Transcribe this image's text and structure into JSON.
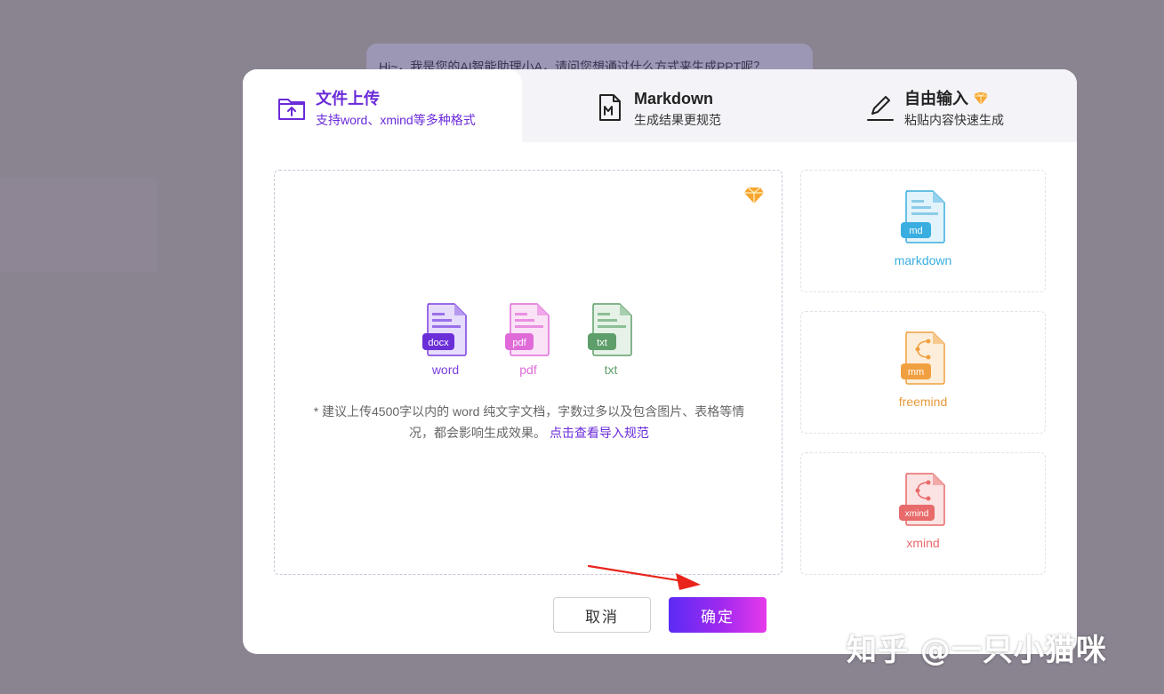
{
  "background": {
    "chat_text": "Hi~，我是您的AI智能助理小A，请问您想通过什么方式来生成PPT呢？"
  },
  "tabs": [
    {
      "title": "文件上传",
      "subtitle": "支持word、xmind等多种格式",
      "icon": "upload-file-icon",
      "active": true
    },
    {
      "title": "Markdown",
      "subtitle": "生成结果更规范",
      "icon": "markdown-file-icon",
      "active": false
    },
    {
      "title": "自由输入",
      "subtitle": "粘贴内容快速生成",
      "icon": "pen-icon",
      "badge": "gem-icon",
      "active": false
    }
  ],
  "upload": {
    "badge": "gem-icon",
    "file_types": [
      {
        "tag": "docx",
        "label": "word",
        "color": "#7c3fe0"
      },
      {
        "tag": "pdf",
        "label": "pdf",
        "color": "#e06bd8"
      },
      {
        "tag": "txt",
        "label": "txt",
        "color": "#5e9e6a"
      }
    ],
    "hint": "* 建议上传4500字以内的 word 纯文字文档，字数过多以及包含图片、表格等情况，都会影响生成效果。",
    "hint_link": "点击查看导入规范"
  },
  "side_cards": [
    {
      "tag": "md",
      "label": "markdown",
      "color": "#3aaee0"
    },
    {
      "tag": "mm",
      "label": "freemind",
      "color": "#f0a040"
    },
    {
      "tag": "xmind",
      "label": "xmind",
      "color": "#e86a6a"
    }
  ],
  "buttons": {
    "cancel": "取消",
    "confirm": "确定"
  },
  "colors": {
    "accent": "#6a2bd9",
    "overlay": "#8a8390"
  },
  "watermark": "知乎 @一只小猫咪"
}
